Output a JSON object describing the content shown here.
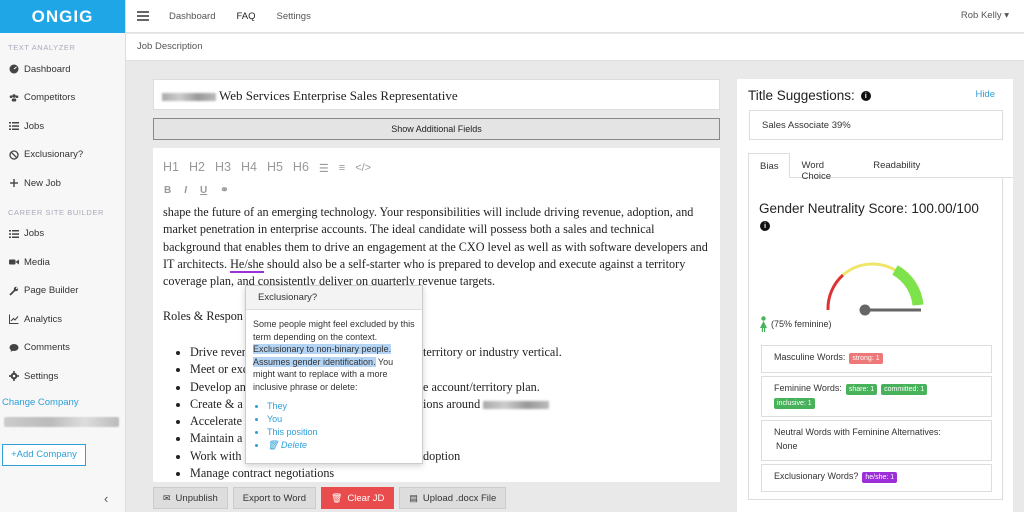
{
  "brand": {
    "logo": "ONGIG"
  },
  "sidebar": {
    "section1": "TEXT ANALYZER",
    "items1": [
      {
        "label": "Dashboard",
        "icon": "dashboard-icon"
      },
      {
        "label": "Competitors",
        "icon": "users-icon"
      },
      {
        "label": "Jobs",
        "icon": "list-icon"
      },
      {
        "label": "Exclusionary?",
        "icon": "ban-icon"
      },
      {
        "label": "New Job",
        "icon": "plus-icon"
      }
    ],
    "section2": "CAREER SITE BUILDER",
    "items2": [
      {
        "label": "Jobs",
        "icon": "list-icon"
      },
      {
        "label": "Media",
        "icon": "video-icon"
      },
      {
        "label": "Page Builder",
        "icon": "wrench-icon"
      },
      {
        "label": "Analytics",
        "icon": "chart-icon"
      },
      {
        "label": "Comments",
        "icon": "comment-icon"
      },
      {
        "label": "Settings",
        "icon": "gear-icon"
      }
    ],
    "change_company": "Change Company",
    "add_company": "+Add Company",
    "collapse": "‹"
  },
  "topbar": {
    "nav": [
      "Dashboard",
      "FAQ",
      "Settings"
    ],
    "user": "Rob Kelly"
  },
  "breadcrumb": "Job Description",
  "editor": {
    "title": "Web Services Enterprise Sales Representative",
    "show_fields": "Show Additional Fields",
    "headings": [
      "H1",
      "H2",
      "H3",
      "H4",
      "H5",
      "H6"
    ],
    "format": [
      "B",
      "I",
      "U"
    ],
    "para_before": "shape the future of an emerging technology. Your responsibilities will include driving revenue, adoption, and market penetration in enterprise accounts. The ideal candidate will possess both a sales and technical background that enables them to drive an engagement at the CXO level as well as with software developers and IT architects. ",
    "flagged_word": "He/she",
    "para_after": " should also be a self-starter who is prepared to develop and execute against a territory coverage plan, and consistently deliver on quarterly revenue targets.",
    "roles": "Roles & Respon",
    "bullets": [
      "Drive reven",
      "Meet or exc",
      "Develop an",
      "Create & a",
      "Accelerate",
      "Maintain a",
      "Work with",
      "Manage contract negotiations"
    ],
    "bullet_tails": [
      "territory or industry vertical.",
      "",
      "e account/territory plan.",
      "ions around",
      "",
      "",
      "doption",
      ""
    ]
  },
  "popover": {
    "title": "Exclusionary?",
    "text1": "Some people might feel excluded by this term depending on the context. ",
    "highlight": "Exclusionary to non-binary people. Assumes gender identification.",
    "text2": " You might want to replace with a more inclusive phrase or delete:",
    "options": [
      "They",
      "You",
      "This position"
    ],
    "delete": "Delete"
  },
  "buttons": {
    "unpublish": "Unpublish",
    "export": "Export to Word",
    "clear": "Clear JD",
    "upload": "Upload .docx File"
  },
  "right": {
    "title": "Title Suggestions:",
    "hide": "Hide",
    "suggestion": "Sales Associate 39%",
    "tabs": [
      "Bias",
      "Word Choice",
      "Readability"
    ],
    "score_label": "Gender Neutrality Score: 100.00/100",
    "gauge_value": 1.0,
    "feminine": "(75% feminine)",
    "masculine_label": "Masculine Words:",
    "masculine_badges": [
      "strong: 1"
    ],
    "feminine_label": "Feminine Words:",
    "feminine_badges": [
      "share: 1",
      "committed: 1",
      "inclusive: 1"
    ],
    "neutral_label": "Neutral Words with Feminine Alternatives:",
    "neutral_value": "None",
    "exclusionary_label": "Exclusionary Words?",
    "exclusionary_badges": [
      "he/she: 1"
    ],
    "colors": {
      "red": "#e77777",
      "green": "#48b25b",
      "purple": "#9b30d9",
      "accent": "#1ea6e6"
    }
  }
}
